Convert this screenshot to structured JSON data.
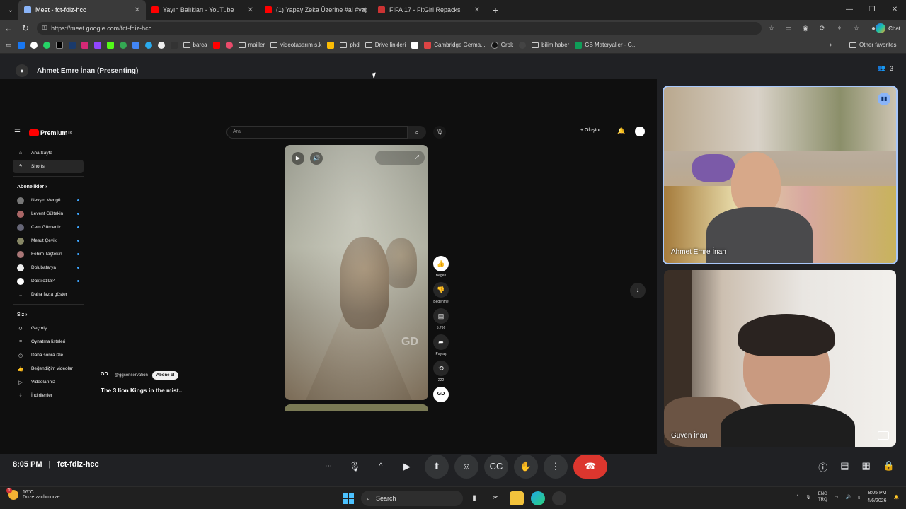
{
  "browser": {
    "tabs": [
      {
        "label": "Meet - fct-fdiz-hcc",
        "color": "#8ab4f8"
      },
      {
        "label": "Yayın Balıkları - YouTube",
        "color": "#ff0000"
      },
      {
        "label": "(1) Yapay Zeka Üzerine #ai #yapay",
        "color": "#ff0000"
      },
      {
        "label": "FIFA 17 - FitGirl Repacks",
        "color": "#c33"
      }
    ],
    "url": "https://meet.google.com/fct-fdiz-hcc",
    "chat_label": "Chat",
    "bookmarks": [
      "barca",
      "mailler",
      "videotasarım s.k",
      "phd",
      "Drive linkleri",
      "Cambridge Germa...",
      "Grok",
      "bilim haber",
      "GB Materyaller - G..."
    ],
    "other_favorites": "Other favorites"
  },
  "meet": {
    "presenter_label": "Ahmet Emre İnan (Presenting)",
    "participant_count": "3",
    "time": "8:05 PM",
    "meeting_code": "fct-fdiz-hcc",
    "tiles": [
      {
        "name": "Ahmet Emre İnan"
      },
      {
        "name": "Güven İnan"
      }
    ]
  },
  "youtube": {
    "logo": "Premium",
    "logo_sup": "TR",
    "search_placeholder": "Ara",
    "create_label": "Oluştur",
    "sidebar_top": [
      "Ana Sayfa",
      "Shorts"
    ],
    "subs_heading": "Abonelikler",
    "subs": [
      "Nevşin Mengü",
      "Levent Gültekin",
      "Cem Gürdeniz",
      "Mesut Çevik",
      "Fehim Taştekin",
      "Dolubatarya",
      "Daktilo1984"
    ],
    "show_more": "Daha fazla göster",
    "you_heading": "Siz",
    "you_items": [
      "Geçmiş",
      "Oynatma listeleri",
      "Daha sonra izle",
      "Beğendiğim videolar",
      "Videolarınız",
      "İndirilenler"
    ],
    "channel_handle": "@ggconservation",
    "subscribe_label": "Abone ol",
    "short_title": "The 3 lion Kings in the mist..",
    "watermark": "GD",
    "actions": {
      "like": "Beğen",
      "dislike": "Beğenme",
      "comments": "5.766",
      "share": "Paylaş",
      "remix": "222"
    }
  },
  "taskbar": {
    "temperature": "16°C",
    "weather": "Duze zachmurze...",
    "search": "Search",
    "lang_1": "ENG",
    "lang_2": "TRQ",
    "time": "8:05 PM",
    "date": "4/6/2026",
    "notification_badge": "1"
  }
}
